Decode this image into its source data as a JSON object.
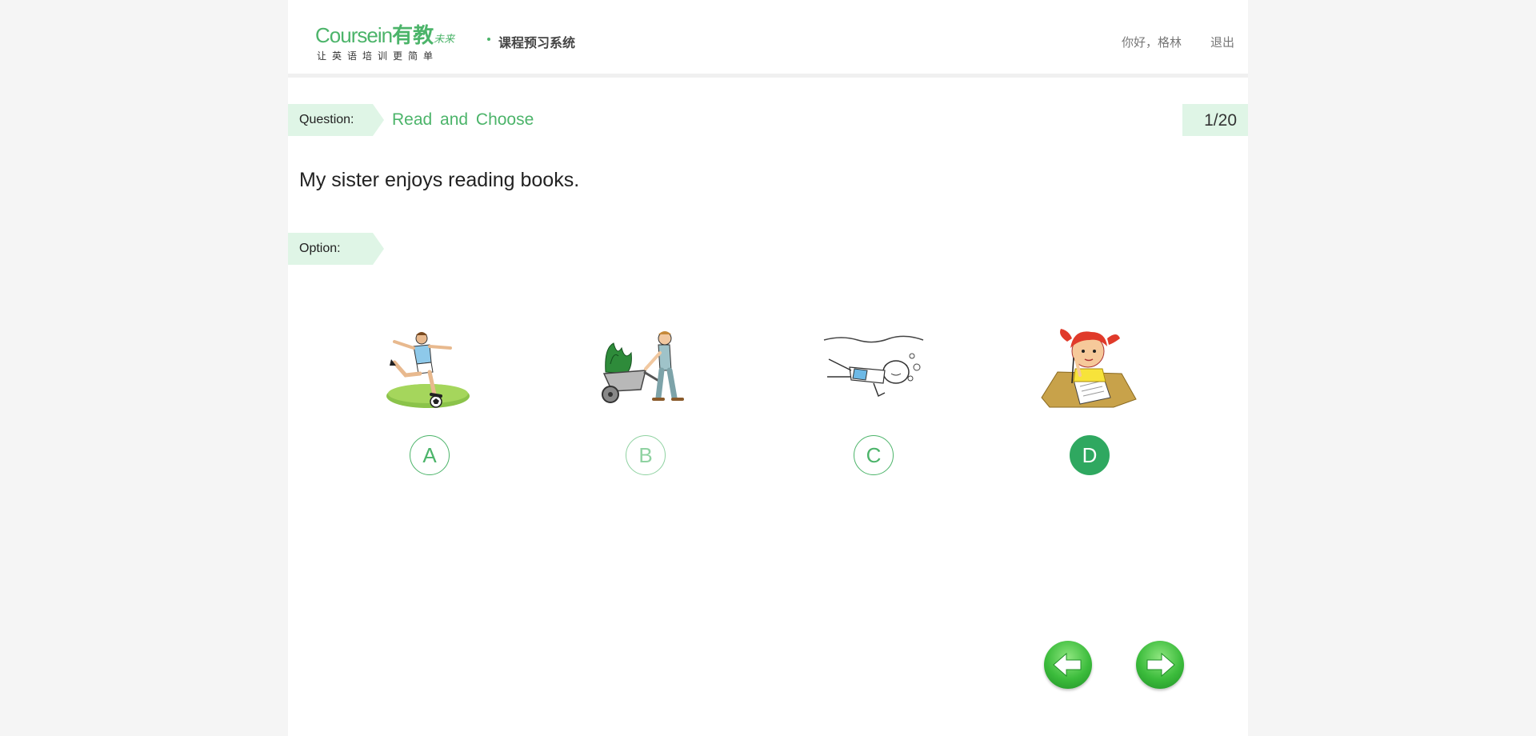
{
  "header": {
    "logo": {
      "brand_en": "Coursein",
      "brand_cn": "有教",
      "brand_sub": "未来",
      "slogan": "让英语培训更简单",
      "system_name": "课程预习系统"
    },
    "greeting": "你好，格林",
    "logout_label": "退出"
  },
  "question": {
    "tag_label": "Question:",
    "type": "Read  and Choose",
    "progress": "1/20",
    "text": "My sister enjoys reading books."
  },
  "options": {
    "tag_label": "Option:",
    "items": [
      {
        "letter": "A",
        "image": "soccer-player-kicking-ball"
      },
      {
        "letter": "B",
        "image": "man-pushing-wheelbarrow-with-plants"
      },
      {
        "letter": "C",
        "image": "child-swimming-underwater"
      },
      {
        "letter": "D",
        "image": "girl-writing-on-paper"
      }
    ],
    "selected": "D"
  },
  "navigation": {
    "prev_icon": "arrow-left-icon",
    "next_icon": "arrow-right-icon"
  },
  "colors": {
    "accent": "#4cb46a",
    "tag_bg": "#dff5e6",
    "selected": "#2fa860"
  }
}
